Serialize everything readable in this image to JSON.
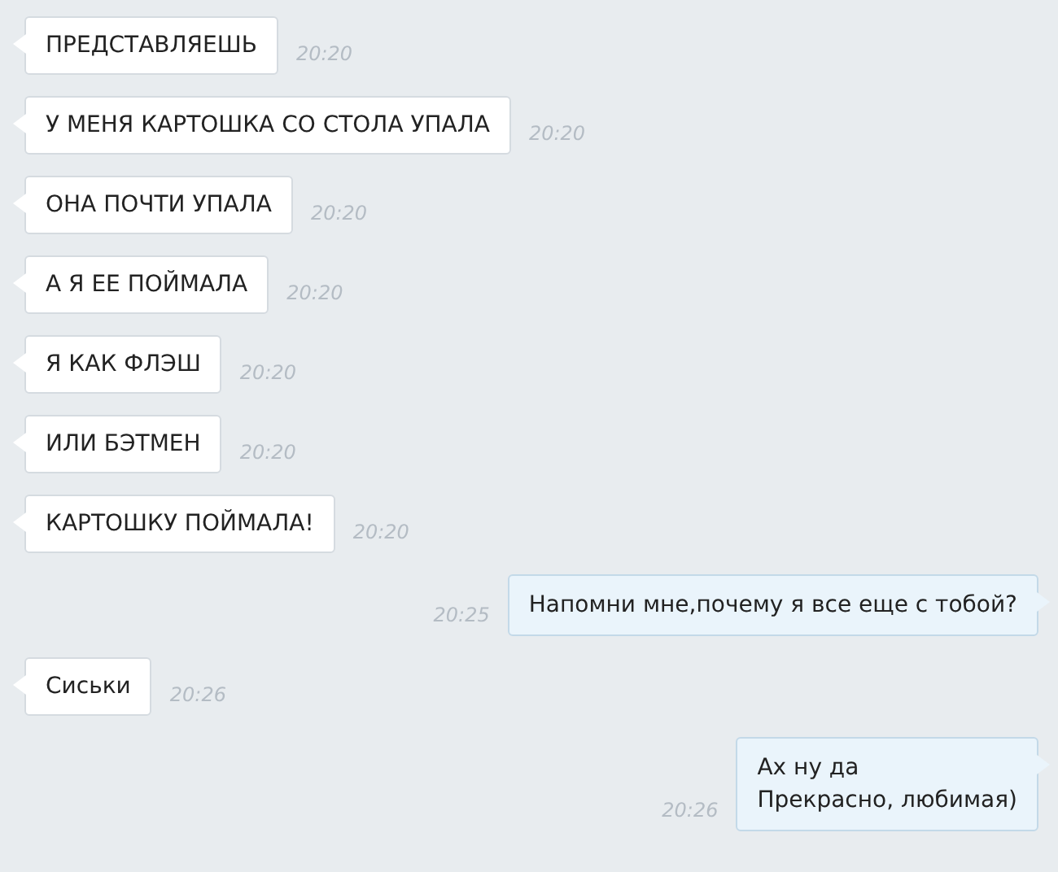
{
  "messages": [
    {
      "kind": "received",
      "text": "ПРЕДСТАВЛЯЕШЬ",
      "time": "20:20"
    },
    {
      "kind": "received",
      "text": "У МЕНЯ КАРТОШКА СО СТОЛА УПАЛА",
      "time": "20:20"
    },
    {
      "kind": "received",
      "text": "ОНА ПОЧТИ УПАЛА",
      "time": "20:20"
    },
    {
      "kind": "received",
      "text": "А Я ЕЕ ПОЙМАЛА",
      "time": "20:20"
    },
    {
      "kind": "received",
      "text": "Я КАК ФЛЭШ",
      "time": "20:20"
    },
    {
      "kind": "received",
      "text": "ИЛИ БЭТМЕН",
      "time": "20:20"
    },
    {
      "kind": "received",
      "text": "КАРТОШКУ ПОЙМАЛА!",
      "time": "20:20"
    },
    {
      "kind": "sent",
      "text": "Напомни мне,почему я все еще с тобой?",
      "time": "20:25"
    },
    {
      "kind": "received",
      "text": "Сиськи",
      "time": "20:26"
    },
    {
      "kind": "sent",
      "text": "Ах ну да\nПрекрасно, любимая)",
      "time": "20:26"
    }
  ]
}
